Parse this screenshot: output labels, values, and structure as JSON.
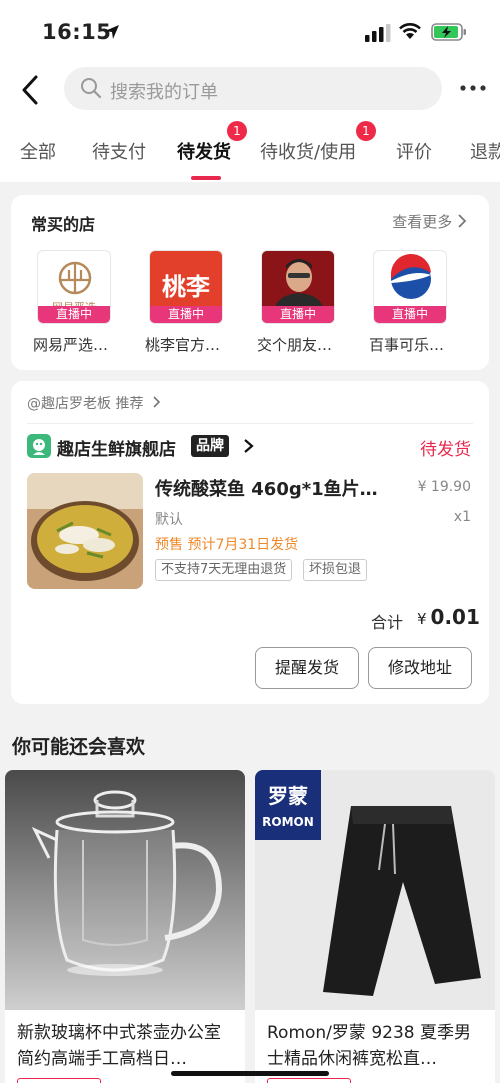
{
  "status_bar": {
    "time": "16:15"
  },
  "header": {
    "search_placeholder": "搜索我的订单"
  },
  "tabs": [
    {
      "label": "全部"
    },
    {
      "label": "待支付"
    },
    {
      "label": "待发货",
      "badge": "1"
    },
    {
      "label": "待收货/使用",
      "badge": "1"
    },
    {
      "label": "评价"
    },
    {
      "label": "退款"
    }
  ],
  "frequent_shops": {
    "title": "常买的店",
    "see_more": "查看更多",
    "live_label": "直播中",
    "shops": [
      {
        "name": "网易严选…",
        "logo_text": "网易严选"
      },
      {
        "name": "桃李官方…",
        "logo_text": "桃李"
      },
      {
        "name": "交个朋友…"
      },
      {
        "name": "百事可乐…"
      }
    ]
  },
  "order": {
    "recommend_line": "@趣店罗老板 推荐",
    "store_name": "趣店生鲜旗舰店",
    "brand_tag": "品牌",
    "status": "待发货",
    "product": {
      "title": "传统酸菜鱼 460g*1鱼片…",
      "price": "¥ 19.90",
      "spec": "默认",
      "qty": "x1",
      "presale": "预售 预计7月31日发货",
      "tags": [
        "不支持7天无理由退货",
        "坏损包退"
      ]
    },
    "total_label": "合计",
    "total_currency": "¥",
    "total_value": "0.01",
    "buttons": {
      "remind": "提醒发货",
      "address": "修改地址"
    }
  },
  "recommend": {
    "title": "你可能还会喜欢",
    "products": [
      {
        "title": "新款玻璃杯中式茶壶办公室简约高端手工高档日…"
      },
      {
        "title": "Romon/罗蒙 9238 夏季男士精品休闲裤宽松直…",
        "brand_cn": "罗蒙",
        "brand_en": "ROMON"
      }
    ]
  },
  "colors": {
    "accent": "#e8284e",
    "presale": "#f0892a",
    "live": "#e8367a"
  }
}
